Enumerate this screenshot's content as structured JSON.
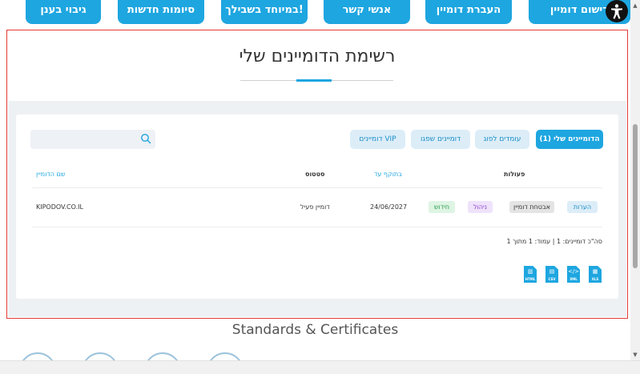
{
  "nav": {
    "items": [
      "רישום דומיין",
      "העברת דומיין",
      "אנשי קשר",
      "במיוחד בשבילך!",
      "סיומות חדשות",
      "גיבוי בענן"
    ]
  },
  "section": {
    "title": "רשימת הדומיינים שלי"
  },
  "tabs": [
    {
      "label": "הדומיינים שלי (1)",
      "active": true
    },
    {
      "label": "עומדים לפוג",
      "active": false
    },
    {
      "label": "דומיינים שפגו",
      "active": false
    },
    {
      "label": "דומיינים VIP",
      "active": false
    }
  ],
  "search": {
    "placeholder": ""
  },
  "table": {
    "headers": {
      "domain_name": "שם הדומיין",
      "status": "סטטוס",
      "valid_until": "בתוקף עד",
      "actions": "פעולות"
    },
    "rows": [
      {
        "domain": "KIPODOV.CO.IL",
        "status": "דומיין פעיל",
        "valid_until": "24/06/2027",
        "actions": {
          "notes": "הערות",
          "protection": "אבטחת דומיין",
          "manage": "ניהול",
          "renew": "חידוש"
        }
      }
    ]
  },
  "summary": "סה\"כ דומיינים: 1  |  עמוד: 1 מתוך 1",
  "export_icons": [
    {
      "name": "xls-export-icon",
      "label": "XLS",
      "glyph": "▦"
    },
    {
      "name": "xml-export-icon",
      "label": "XML",
      "glyph": "</>"
    },
    {
      "name": "csv-export-icon",
      "label": "CSV",
      "glyph": "▤"
    },
    {
      "name": "html-export-icon",
      "label": "HTML",
      "glyph": "▥"
    }
  ],
  "standards": {
    "title": "Standards & Certificates"
  },
  "colors": {
    "accent": "#1ea6e0",
    "frame": "#e53935"
  }
}
